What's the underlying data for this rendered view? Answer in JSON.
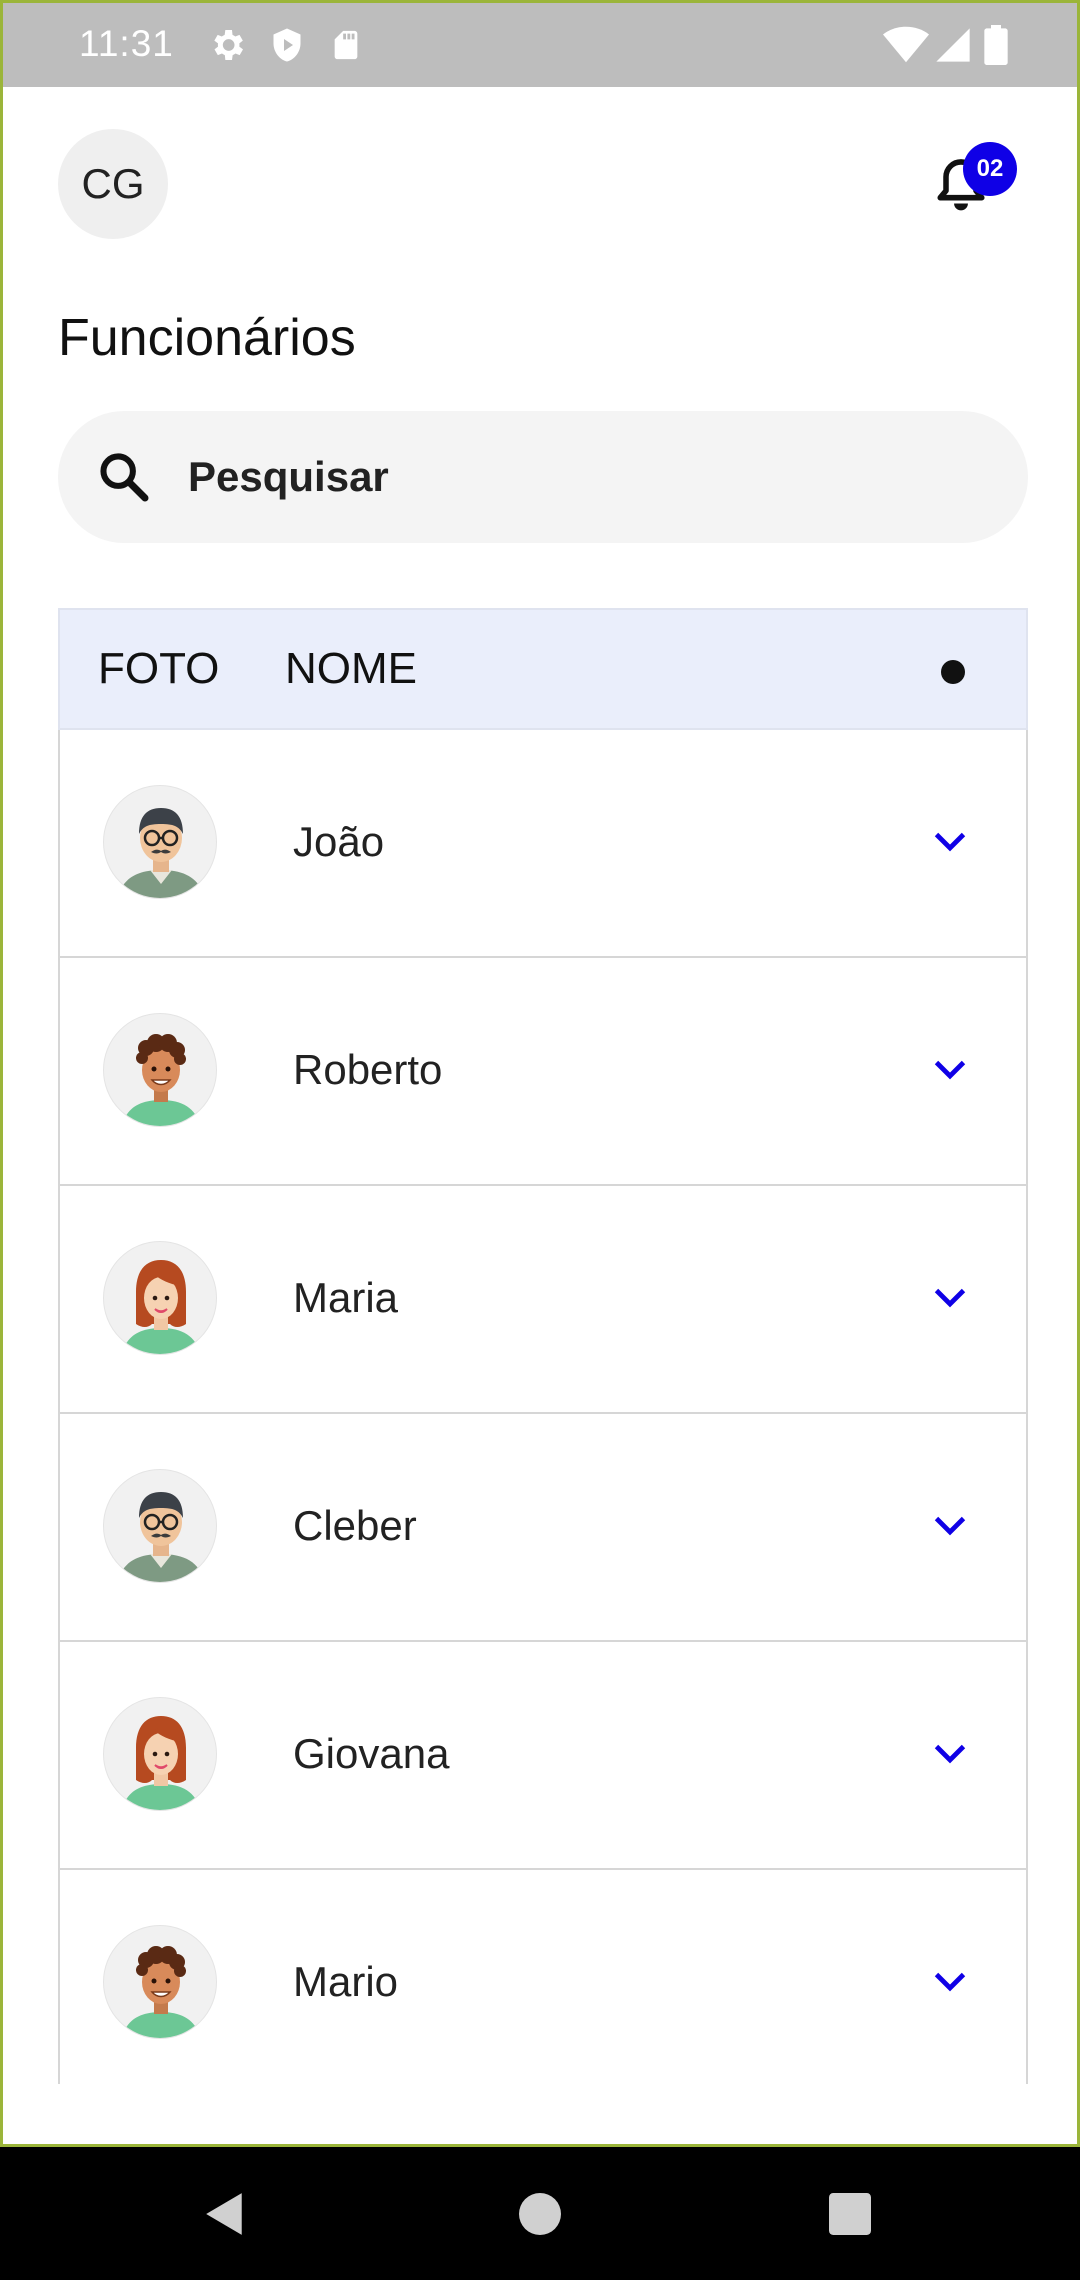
{
  "status_bar": {
    "time": "11:31",
    "icons_left": [
      "gear-icon",
      "shield-icon",
      "sd-card-icon"
    ],
    "icons_right": [
      "wifi-icon",
      "signal-icon",
      "battery-icon"
    ]
  },
  "header": {
    "avatar_initials": "CG",
    "notification_count": "02",
    "notification_icon": "bell-icon"
  },
  "page_title": "Funcionários",
  "search": {
    "placeholder": "Pesquisar",
    "value": ""
  },
  "table": {
    "columns": {
      "foto": "FOTO",
      "nome": "NOME"
    },
    "rows": [
      {
        "name": "João",
        "avatar": "older-man-glasses"
      },
      {
        "name": "Roberto",
        "avatar": "young-man-curly"
      },
      {
        "name": "Maria",
        "avatar": "woman-red-hair"
      },
      {
        "name": "Cleber",
        "avatar": "older-man-glasses"
      },
      {
        "name": "Giovana",
        "avatar": "woman-red-hair"
      },
      {
        "name": "Mario",
        "avatar": "young-man-curly"
      }
    ]
  },
  "nav_bar": [
    "back-icon",
    "home-icon",
    "recents-icon"
  ],
  "colors": {
    "accent": "#0f00e6",
    "frame": "#9bb53a",
    "header_bg": "#eaeefb"
  }
}
